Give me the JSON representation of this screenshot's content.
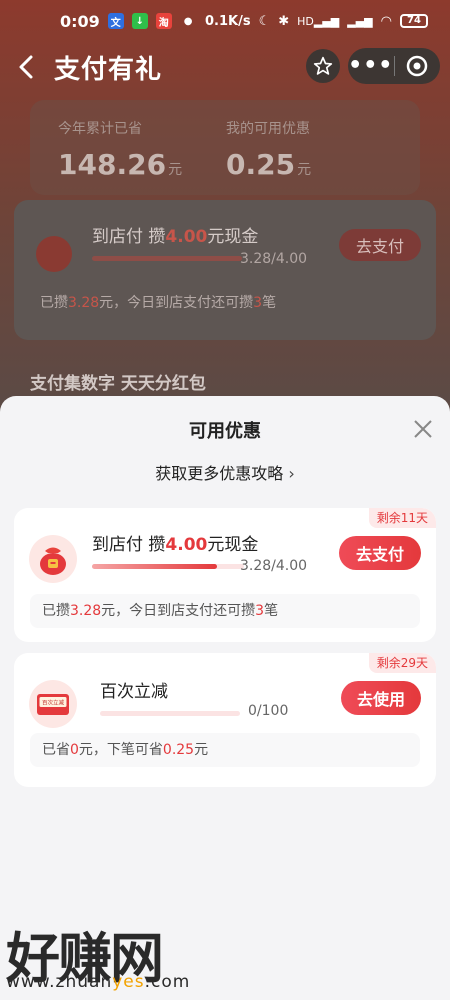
{
  "status_bar": {
    "time": "0:09",
    "network_speed": "0.1K/s",
    "signal_label": "HD",
    "battery": "74"
  },
  "header": {
    "title": "支付有礼"
  },
  "summary": {
    "saved_label": "今年累计已省",
    "saved_value": "148.26",
    "saved_unit": "元",
    "available_label": "我的可用优惠",
    "available_value": "0.25",
    "available_unit": "元"
  },
  "background_card": {
    "title_prefix": "到店付 攒",
    "title_amount": "4.00",
    "title_suffix": "元现金",
    "progress_text": "3.28/4.00",
    "button": "去支付",
    "sub_prefix": "已攒",
    "sub_amount": "3.28",
    "sub_mid": "元，今日到店支付还可攒",
    "sub_count": "3",
    "sub_suffix": "笔"
  },
  "background_section_title": "支付集数字 天天分红包",
  "sheet": {
    "title": "可用优惠",
    "more_link": "获取更多优惠攻略",
    "coupons": [
      {
        "tag": "剩余11天",
        "title_prefix": "到店付 攒",
        "title_amount": "4.00",
        "title_suffix": "元现金",
        "progress_text": "3.28/4.00",
        "progress_fraction": 0.82,
        "button": "去支付",
        "sub_prefix": "已攒",
        "sub_amount": "3.28",
        "sub_mid": "元，今日到店支付还可攒",
        "sub_count": "3",
        "sub_suffix": "笔"
      },
      {
        "tag": "剩余29天",
        "title": "百次立减",
        "icon_text": "百次立减",
        "progress_text": "0/100",
        "progress_fraction": 0,
        "button": "去使用",
        "sub_prefix": "已省",
        "sub_amount": "0",
        "sub_mid": "元，下笔可省",
        "sub_next": "0.25",
        "sub_suffix": "元"
      }
    ]
  },
  "watermark": {
    "big": "好赚网",
    "url_prefix": "www.zhuan",
    "url_highlight": "yes",
    "url_suffix": ".com"
  },
  "colors": {
    "accent": "#e4393c",
    "sheet_bg": "#f4f4f6"
  }
}
